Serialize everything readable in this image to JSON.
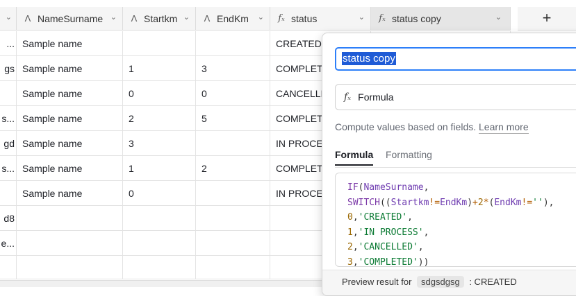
{
  "columns": [
    {
      "key": "c0",
      "label": "",
      "icon": "chevron-down-icon"
    },
    {
      "key": "name",
      "label": "NameSurname",
      "icon": "text-icon"
    },
    {
      "key": "start",
      "label": "Startkm",
      "icon": "text-icon"
    },
    {
      "key": "end",
      "label": "EndKm",
      "icon": "text-icon"
    },
    {
      "key": "status",
      "label": "status",
      "icon": "formula-icon"
    },
    {
      "key": "status_copy",
      "label": "status copy",
      "icon": "formula-icon"
    }
  ],
  "rows": [
    {
      "c0": "...",
      "name": "Sample name",
      "start": "",
      "end": "",
      "status": "CREATED"
    },
    {
      "c0": "gs",
      "name": "Sample name",
      "start": "1",
      "end": "3",
      "status": "COMPLETED"
    },
    {
      "c0": "",
      "name": "Sample name",
      "start": "0",
      "end": "0",
      "status": "CANCELLED"
    },
    {
      "c0": "s...",
      "name": "Sample name",
      "start": "2",
      "end": "5",
      "status": "COMPLETED"
    },
    {
      "c0": "gd",
      "name": "Sample name",
      "start": "3",
      "end": "",
      "status": "IN PROCESS"
    },
    {
      "c0": "s...",
      "name": "Sample name",
      "start": "1",
      "end": "2",
      "status": "COMPLETED"
    },
    {
      "c0": "",
      "name": "Sample name",
      "start": "0",
      "end": "",
      "status": "IN PROCESS"
    },
    {
      "c0": "d8",
      "name": "",
      "start": "",
      "end": "",
      "status": ""
    },
    {
      "c0": "e...",
      "name": "",
      "start": "",
      "end": "",
      "status": ""
    }
  ],
  "add_column_label": "+",
  "panel": {
    "field_name": "status copy",
    "field_type": "Formula",
    "description": "Compute values based on fields.",
    "learn_more": "Learn more",
    "tabs": [
      "Formula",
      "Formatting"
    ],
    "formula_lines": [
      "IF(NameSurname,",
      "SWITCH((Startkm!=EndKm)+2*(EndKm!=''),",
      "0,'CREATED',",
      "1,'IN PROCESS',",
      "2,'CANCELLED',",
      "3,'COMPLETED'))"
    ],
    "preview_label": "Preview result for",
    "preview_record": "sdgsdgsg",
    "preview_result": ": CREATED"
  },
  "colors": {
    "accent": "#2d7ff9",
    "selection": "#1f5bd6"
  }
}
